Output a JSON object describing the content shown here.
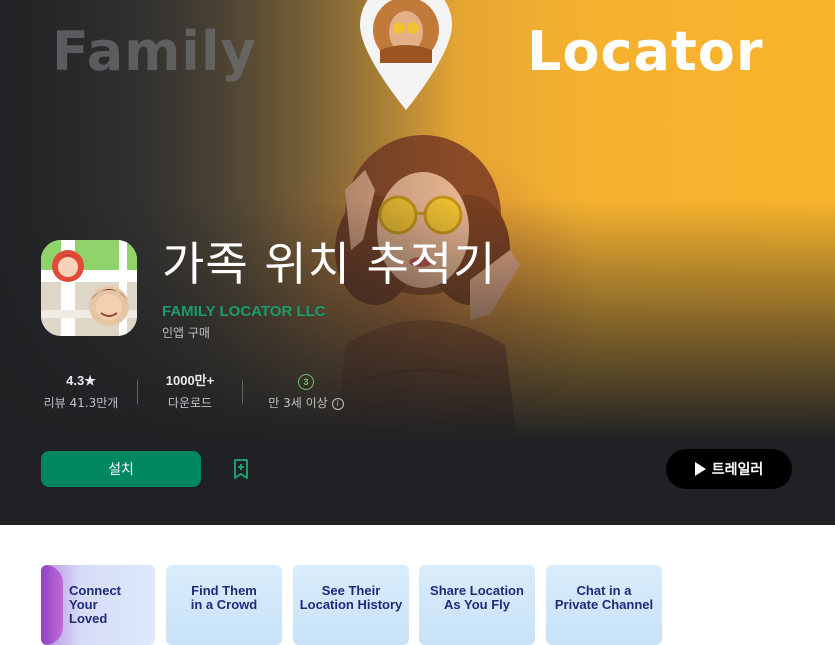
{
  "banner": {
    "word_left": "Family",
    "word_right": "Locator"
  },
  "app": {
    "title": "가족 위치 추적기",
    "developer": "FAMILY LOCATOR LLC",
    "iap_note": "인앱 구매"
  },
  "stats": {
    "rating": "4.3★",
    "reviews": "리뷰 41.3만개",
    "downloads": "1000만+",
    "downloads_label": "다운로드",
    "age_badge": "3",
    "age_label": "만 3세 이상",
    "info_glyph": "i"
  },
  "actions": {
    "install": "설치",
    "trailer": "트레일러"
  },
  "screenshots": [
    {
      "caption": "Connect Your Loved"
    },
    {
      "caption": "Find Them in a Crowd"
    },
    {
      "caption": "See Their Location History"
    },
    {
      "caption": "Share Location As You Fly"
    },
    {
      "caption": "Chat in a Private Channel"
    }
  ],
  "colors": {
    "install_green": "#01875f",
    "developer_green": "#1a9d6d",
    "hero_dark": "#202124",
    "banner_yellow": "#f8b42b"
  },
  "icons": [
    "map-pin-icon",
    "bookmark-add-icon",
    "play-icon",
    "info-icon",
    "age-rating-icon"
  ]
}
